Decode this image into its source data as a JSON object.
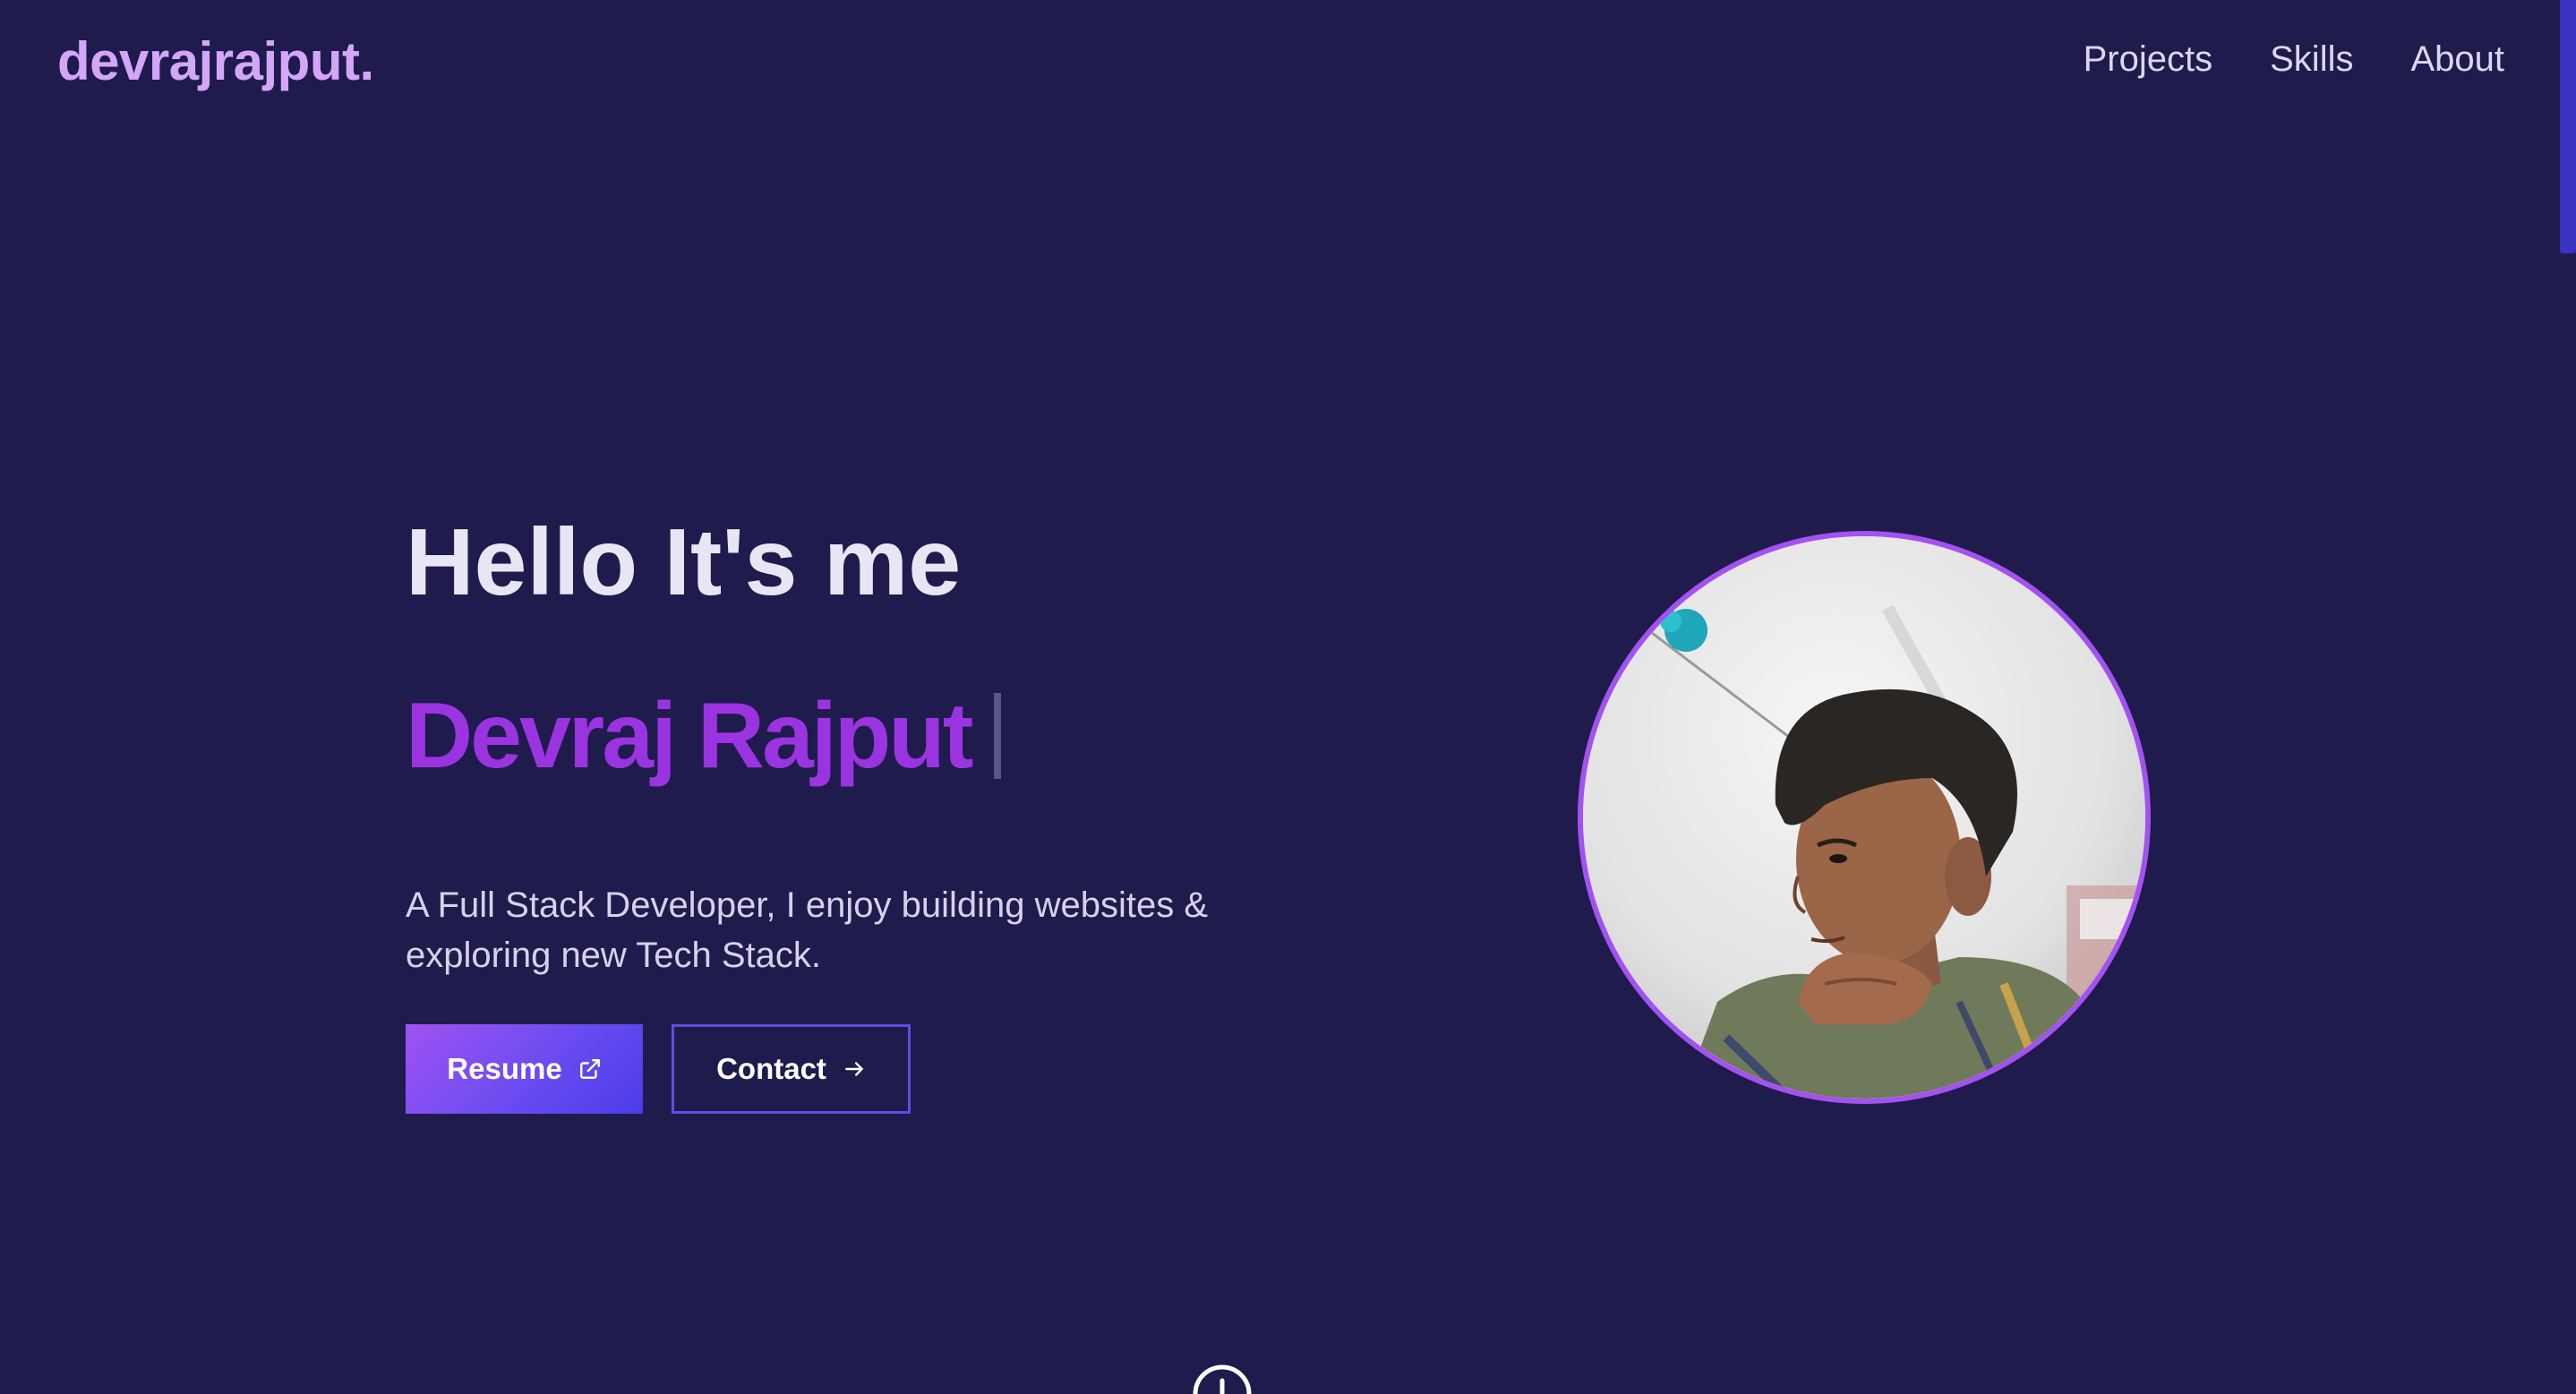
{
  "header": {
    "logo": "devrajrajput.",
    "nav": [
      "Projects",
      "Skills",
      "About"
    ]
  },
  "hero": {
    "greeting": "Hello It's me",
    "name": "Devraj Rajput",
    "description": "A Full Stack Developer, I enjoy building websites & exploring new Tech Stack.",
    "buttons": {
      "resume": "Resume",
      "contact": "Contact"
    }
  },
  "icons": {
    "resume": "external-link-icon",
    "contact": "arrow-right-icon",
    "scroll": "scroll-down-icon"
  },
  "colors": {
    "background": "#1f1b4d",
    "logo": "#d4a6f7",
    "name": "#9a34e0",
    "accent": "#a352f0",
    "button_gradient_start": "#a052f3",
    "button_gradient_end": "#4a3ce8",
    "contact_border": "#5b4fe3"
  }
}
